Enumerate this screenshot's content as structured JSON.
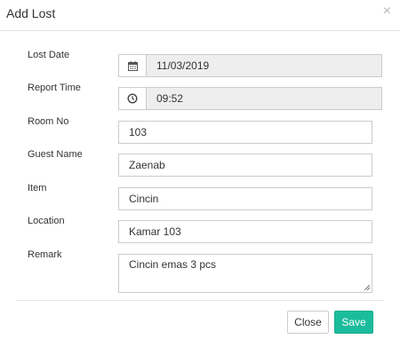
{
  "dialog": {
    "title": "Add Lost",
    "close_glyph": "×"
  },
  "fields": {
    "lost_date": {
      "label": "Lost Date",
      "value": "11/03/2019",
      "icon": "calendar-icon"
    },
    "report_time": {
      "label": "Report Time",
      "value": "09:52",
      "icon": "clock-icon"
    },
    "room_no": {
      "label": "Room No",
      "value": "103"
    },
    "guest_name": {
      "label": "Guest Name",
      "value": "Zaenab"
    },
    "item": {
      "label": "Item",
      "value": "Cincin"
    },
    "location": {
      "label": "Location",
      "value": "Kamar 103"
    },
    "remark": {
      "label": "Remark",
      "value": "Cincin emas 3 pcs"
    }
  },
  "footer": {
    "close_label": "Close",
    "save_label": "Save"
  },
  "colors": {
    "save_button": "#1abc9c",
    "readonly_field": "#eeeeee"
  }
}
